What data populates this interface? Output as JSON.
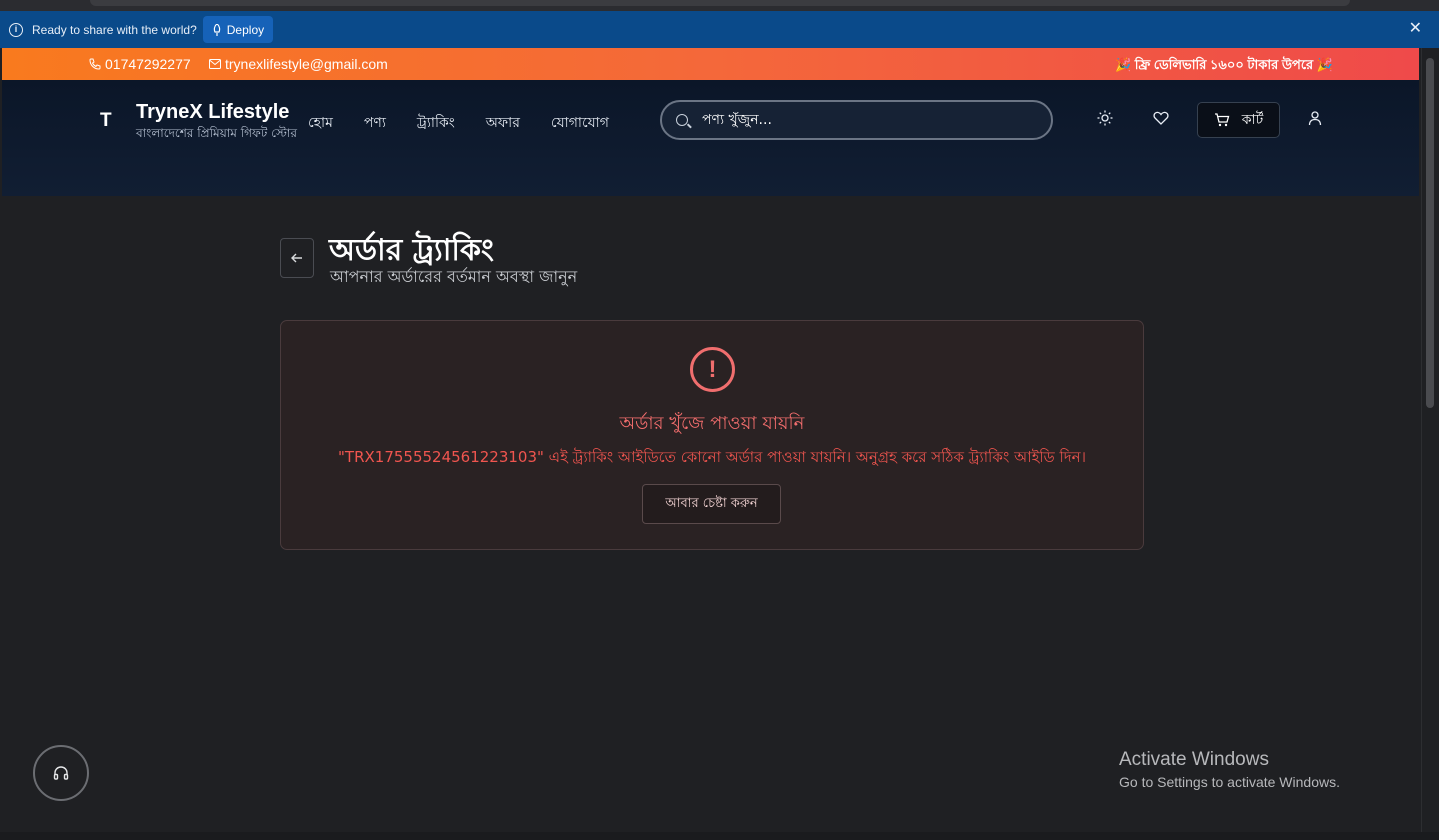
{
  "deploy_bar": {
    "message": "Ready to share with the world?",
    "button_label": "Deploy",
    "close_glyph": "✕"
  },
  "topbar": {
    "phone": "01747292277",
    "email": "trynexlifestyle@gmail.com",
    "offer": "🎉 ফ্রি ডেলিভারি ১৬০০ টাকার উপরে 🎉"
  },
  "header": {
    "logo_mark": "T",
    "brand": "TryneX Lifestyle",
    "tagline": "বাংলাদেশের প্রিমিয়াম গিফট স্টোর",
    "nav": [
      "হোম",
      "পণ্য",
      "ট্র্যাকিং",
      "অফার",
      "যোগাযোগ"
    ],
    "search_placeholder": "পণ্য খুঁজুন...",
    "cart_label": "কার্ট"
  },
  "page": {
    "title": "অর্ডার ট্র্যাকিং",
    "subtitle": "আপনার অর্ডারের বর্তমান অবস্থা জানুন"
  },
  "error": {
    "icon_glyph": "!",
    "title": "অর্ডার খুঁজে পাওয়া যায়নি",
    "message": "\"TRX17555524561223103\" এই ট্র্যাকিং আইডিতে কোনো অর্ডার পাওয়া যায়নি। অনুগ্রহ করে সঠিক ট্র্যাকিং আইডি দিন।",
    "retry_label": "আবার চেষ্টা করুন"
  },
  "watermark": {
    "title": "Activate Windows",
    "subtitle": "Go to Settings to activate Windows."
  },
  "icons": {
    "info": "info-icon",
    "phone": "phone-icon",
    "email": "mail-icon",
    "search": "search-icon",
    "theme": "sun-icon",
    "wishlist": "heart-icon",
    "cart": "cart-icon",
    "account": "user-icon",
    "back": "arrow-left-icon",
    "error": "alert-circle-icon",
    "support": "headphones-icon"
  },
  "colors": {
    "deploy_bar": "#0a4a8a",
    "promo_start": "#f97a1e",
    "promo_end": "#ef4a4a",
    "navbar": "#0b1628",
    "error_accent": "#f06e6e",
    "background": "#1f2023"
  }
}
